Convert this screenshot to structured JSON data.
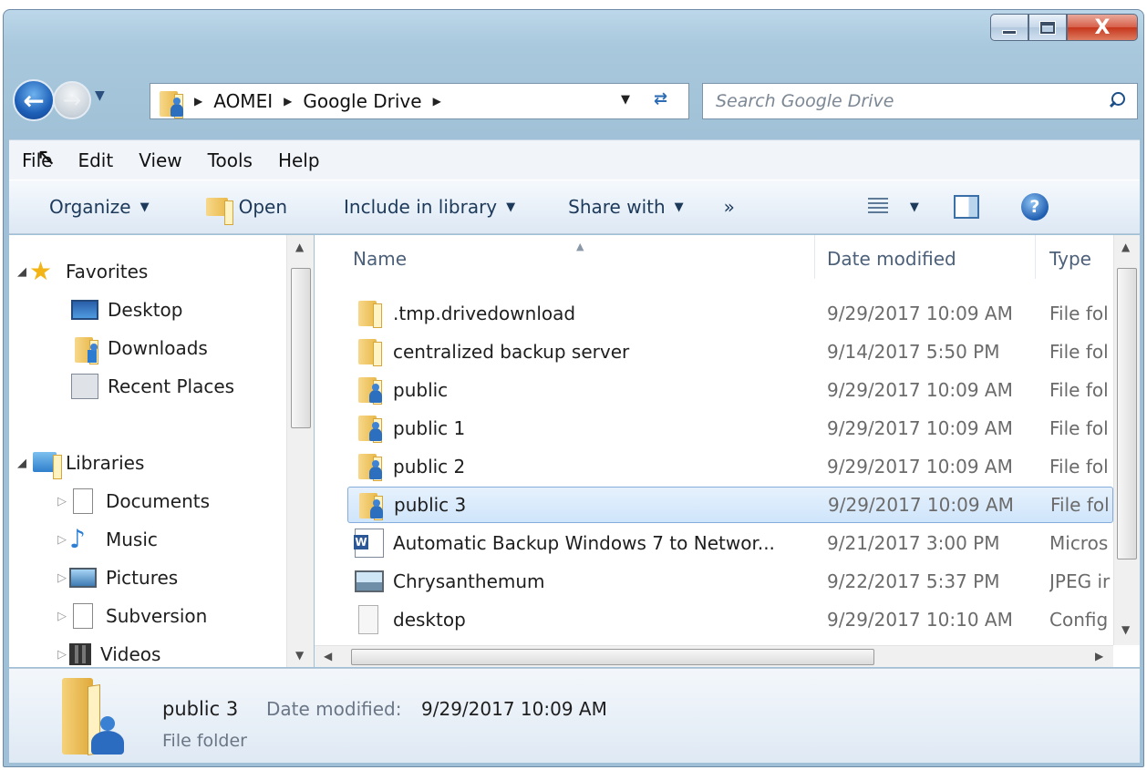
{
  "window": {
    "minimize": "—",
    "maximize": "□",
    "close": "X"
  },
  "address": {
    "crumbs": [
      "AOMEI",
      "Google Drive"
    ]
  },
  "search": {
    "placeholder": "Search Google Drive"
  },
  "menu": [
    "File",
    "Edit",
    "View",
    "Tools",
    "Help"
  ],
  "commands": {
    "organize": "Organize",
    "open": "Open",
    "include": "Include in library",
    "share": "Share with",
    "more": "»"
  },
  "nav": {
    "favorites": "Favorites",
    "desktop": "Desktop",
    "downloads": "Downloads",
    "recent": "Recent Places",
    "libraries": "Libraries",
    "documents": "Documents",
    "music": "Music",
    "pictures": "Pictures",
    "subversion": "Subversion",
    "videos": "Videos"
  },
  "columns": {
    "name": "Name",
    "date": "Date modified",
    "type": "Type"
  },
  "files": [
    {
      "name": ".tmp.drivedownload",
      "date": "9/29/2017 10:09 AM",
      "type": "File fol",
      "icon": "folder-icon"
    },
    {
      "name": "centralized backup server",
      "date": "9/14/2017 5:50 PM",
      "type": "File fol",
      "icon": "folder-icon"
    },
    {
      "name": "public",
      "date": "9/29/2017 10:09 AM",
      "type": "File fol",
      "icon": "shared-folder-icon"
    },
    {
      "name": "public 1",
      "date": "9/29/2017 10:09 AM",
      "type": "File fol",
      "icon": "shared-folder-icon"
    },
    {
      "name": "public 2",
      "date": "9/29/2017 10:09 AM",
      "type": "File fol",
      "icon": "shared-folder-icon"
    },
    {
      "name": "public 3",
      "date": "9/29/2017 10:09 AM",
      "type": "File fol",
      "icon": "shared-folder-icon",
      "selected": true
    },
    {
      "name": "Automatic Backup Windows 7 to Networ...",
      "date": "9/21/2017 3:00 PM",
      "type": "Micros",
      "icon": "word-doc-icon"
    },
    {
      "name": "Chrysanthemum",
      "date": "9/22/2017 5:37 PM",
      "type": "JPEG ir",
      "icon": "image-icon"
    },
    {
      "name": "desktop",
      "date": "9/29/2017 10:10 AM",
      "type": "Config",
      "icon": "config-file-icon"
    }
  ],
  "details": {
    "name": "public 3",
    "date_label": "Date modified:",
    "date_value": "9/29/2017 10:09 AM",
    "type": "File folder"
  },
  "colors": {
    "accent": "#2d6fbf",
    "selection": "#cfe5fb",
    "folder": "#e9b849"
  }
}
